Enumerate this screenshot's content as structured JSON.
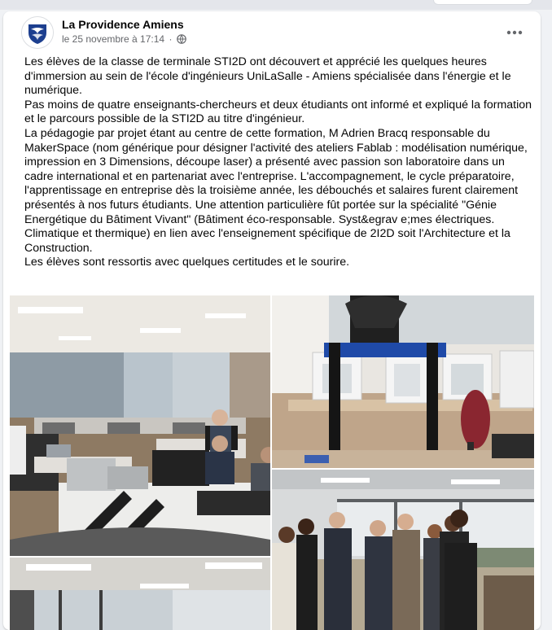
{
  "post": {
    "page_name": "La Providence Amiens",
    "timestamp": "le 25 novembre à 17:14",
    "separator": "·",
    "privacy_icon": "globe-icon",
    "more_icon": "more-horizontal-icon",
    "paragraphs": [
      "Les élèves de la classe de terminale STI2D ont découvert et apprécié les quelques heures d'immersion au sein de l'école d'ingénieurs UniLaSalle - Amiens spécialisée dans l'énergie et le numérique.",
      "Pas moins de quatre enseignants-chercheurs et deux étudiants ont informé et expliqué la formation et le parcours possible de la STI2D au titre d'ingénieur.",
      "La pédagogie par projet étant au centre de cette formation, M Adrien Bracq responsable du MakerSpace (nom générique pour désigner l'activité des ateliers Fablab : modélisation numérique, impression en 3 Dimensions, découpe laser) a présenté avec passion son laboratoire dans un cadre international et en partenariat avec l'entreprise. L'accompagnement, le cycle préparatoire, l'apprentissage en entreprise dès la troisième année, les débouchés et salaires furent clairement présentés à nos futurs étudiants. Une attention particulière fût portée sur la spécialité \"Génie Energétique du Bâtiment Vivant\" (Bâtiment éco-responsable. Syst&egrav e;mes électriques. Climatique et thermique) en lien avec l'enseignement spécifique de 2I2D soit l'Architecture et la Construction.",
      "Les élèves sont ressortis avec quelques certitudes et le sourire."
    ]
  },
  "photos": [
    {
      "name": "photo-electronics-lab",
      "description_icon": "photo-icon"
    },
    {
      "name": "photo-3d-printers",
      "description_icon": "photo-icon"
    },
    {
      "name": "photo-students-group",
      "description_icon": "photo-icon"
    },
    {
      "name": "photo-classroom-ceiling",
      "description_icon": "photo-icon"
    }
  ],
  "colors": {
    "page_bg": "#f0f2f5",
    "card_bg": "#ffffff",
    "text_primary": "#050505",
    "text_secondary": "#65676b",
    "logo_blue": "#1d3f8f"
  }
}
